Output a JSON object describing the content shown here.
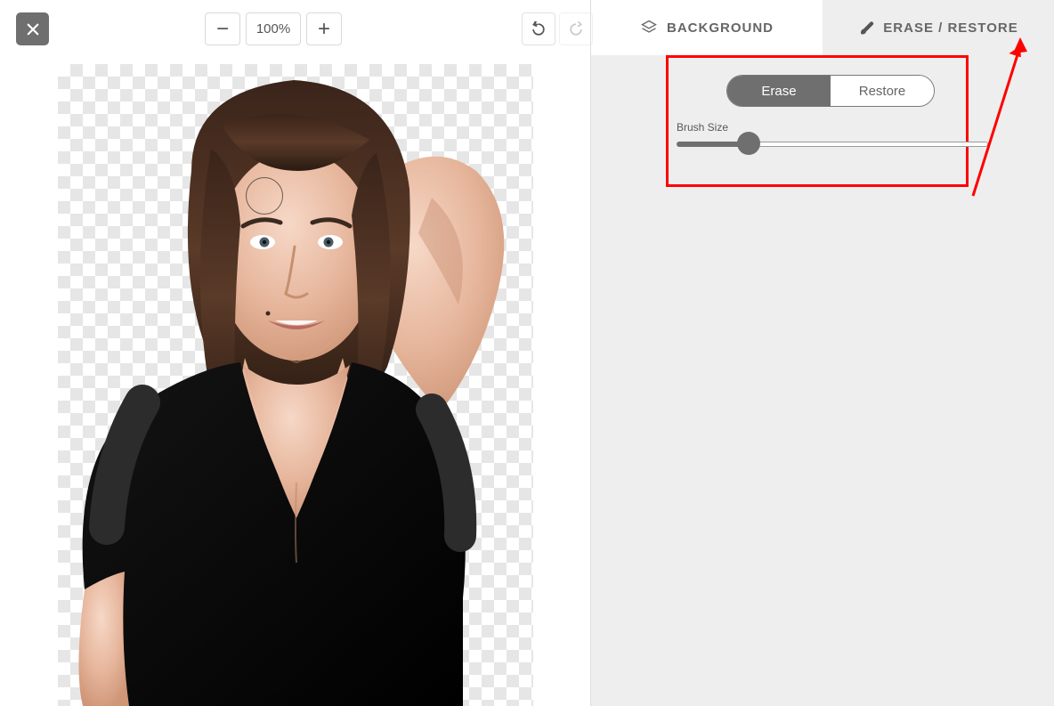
{
  "toolbar": {
    "zoom_value": "100%",
    "zoom_out_glyph": "−",
    "zoom_in_glyph": "+"
  },
  "tabs": {
    "background": "BACKGROUND",
    "erase_restore": "ERASE / RESTORE"
  },
  "panel": {
    "erase_label": "Erase",
    "restore_label": "Restore",
    "brush_size_label": "Brush Size",
    "brush_slider_value": 22
  }
}
